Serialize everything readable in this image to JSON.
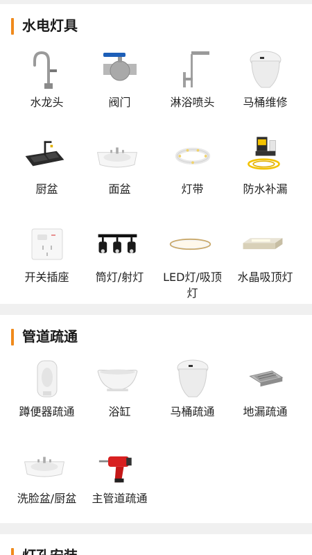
{
  "sections": [
    {
      "title": "水电灯具",
      "items": [
        {
          "label": "水龙头",
          "icon": "faucet-icon"
        },
        {
          "label": "阀门",
          "icon": "valve-icon"
        },
        {
          "label": "淋浴喷头",
          "icon": "shower-icon"
        },
        {
          "label": "马桶维修",
          "icon": "toilet-icon"
        },
        {
          "label": "厨盆",
          "icon": "kitchen-sink-icon"
        },
        {
          "label": "面盆",
          "icon": "basin-icon"
        },
        {
          "label": "灯带",
          "icon": "light-strip-icon"
        },
        {
          "label": "防水补漏",
          "icon": "pump-icon"
        },
        {
          "label": "开关插座",
          "icon": "switch-socket-icon"
        },
        {
          "label": "筒灯/射灯",
          "icon": "spotlight-icon"
        },
        {
          "label": "LED灯/吸顶灯",
          "icon": "ceiling-light-icon"
        },
        {
          "label": "水晶吸顶灯",
          "icon": "crystal-light-icon"
        }
      ]
    },
    {
      "title": "管道疏通",
      "items": [
        {
          "label": "蹲便器疏通",
          "icon": "squat-toilet-icon"
        },
        {
          "label": "浴缸",
          "icon": "bathtub-icon"
        },
        {
          "label": "马桶疏通",
          "icon": "toilet-icon"
        },
        {
          "label": "地漏疏通",
          "icon": "floor-drain-icon"
        },
        {
          "label": "洗脸盆/厨盆",
          "icon": "basin-icon"
        },
        {
          "label": "主管道疏通",
          "icon": "drill-icon"
        }
      ]
    },
    {
      "title": "灯孔安装"
    }
  ],
  "colors": {
    "accent": "#f08a1c",
    "background": "#f0f0f0",
    "card": "#ffffff"
  }
}
